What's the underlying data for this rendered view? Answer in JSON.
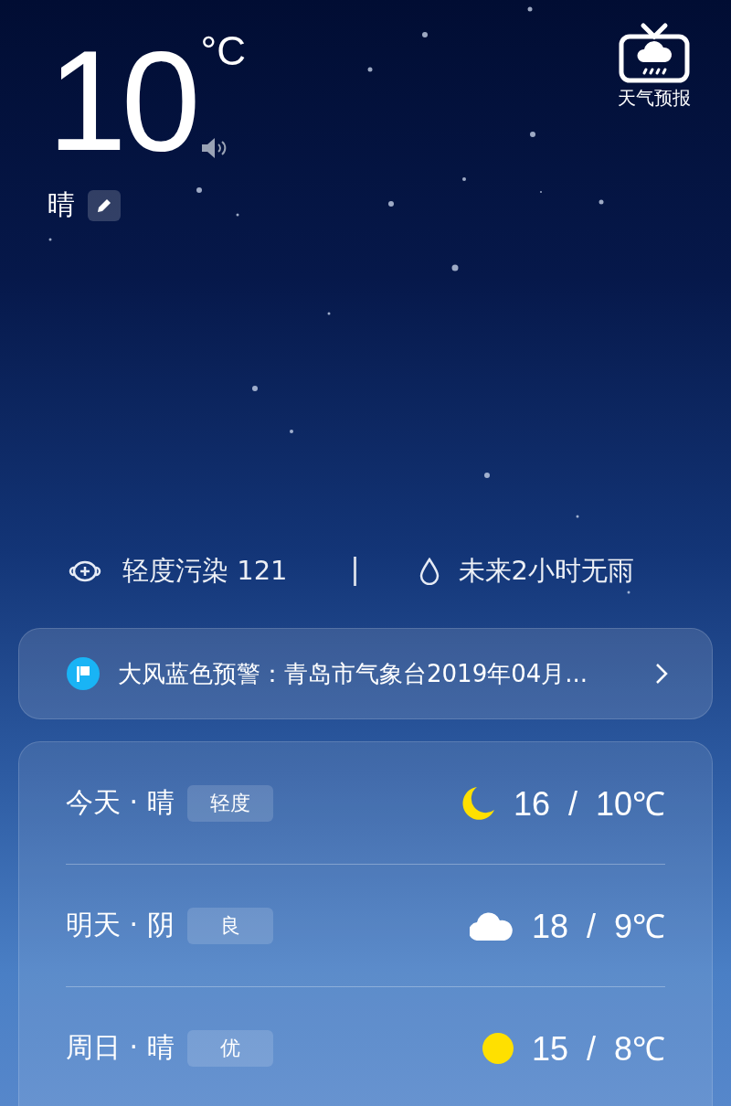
{
  "current": {
    "temperature": "10",
    "unit": "°C",
    "condition": "晴"
  },
  "forecast_button": {
    "label": "天气预报"
  },
  "air_quality": {
    "text": "轻度污染 121"
  },
  "rain": {
    "text": "未来2小时无雨"
  },
  "alert": {
    "text": "大风蓝色预警：青岛市气象台2019年04月..."
  },
  "days": [
    {
      "label": "今天 · 晴",
      "aqi": "轻度",
      "kind": "moon",
      "temps": "16  /  10℃"
    },
    {
      "label": "明天 · 阴",
      "aqi": "良",
      "kind": "cloud",
      "temps": "18  /  9℃"
    },
    {
      "label": "周日 · 晴",
      "aqi": "优",
      "kind": "sun",
      "temps": "15  /  8℃"
    }
  ]
}
